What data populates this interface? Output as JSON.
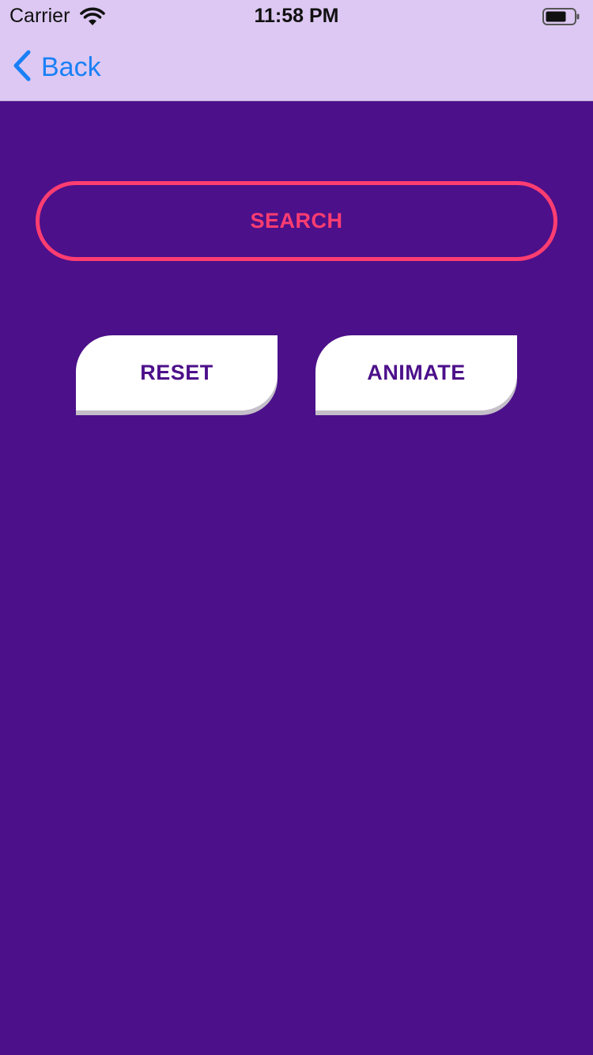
{
  "status_bar": {
    "carrier": "Carrier",
    "time": "11:58 PM",
    "wifi_icon": "wifi-icon",
    "battery_icon": "battery-icon"
  },
  "nav": {
    "back_label": "Back",
    "back_icon": "chevron-left-icon"
  },
  "main": {
    "search_label": "SEARCH",
    "reset_label": "RESET",
    "animate_label": "ANIMATE"
  },
  "colors": {
    "background": "#4c108a",
    "topbar": "#dcc8f2",
    "accent_pink": "#ff3d71",
    "button_fill": "#ffffff",
    "link_blue": "#1a80f7"
  }
}
